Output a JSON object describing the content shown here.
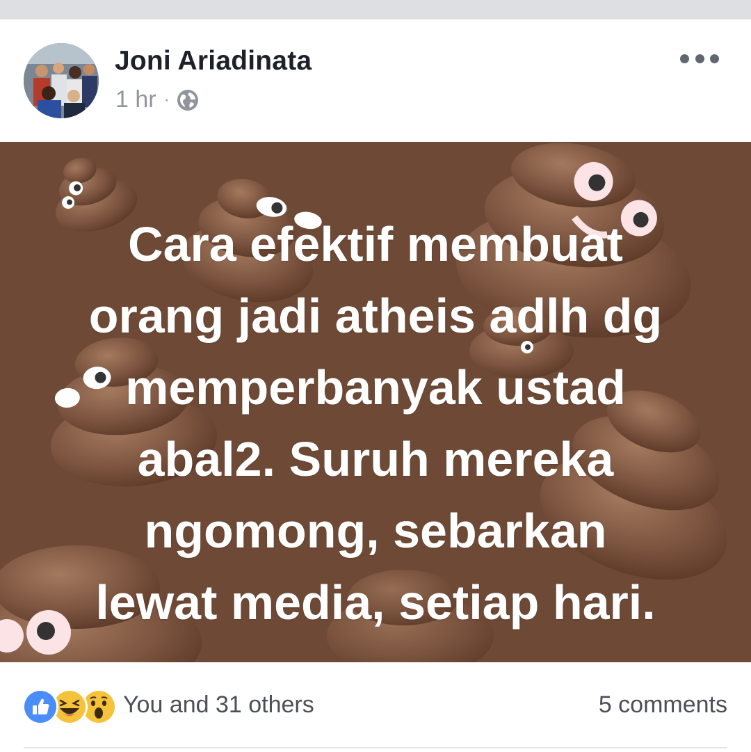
{
  "post": {
    "author": "Joni Ariadinata",
    "time": "1 hr",
    "separator": "·",
    "privacy_icon": "globe-icon",
    "more_icon": "more-options-icon",
    "image_text_lines": [
      "Cara efektif membuat",
      "orang jadi atheis adlh dg",
      "memperbanyak ustad",
      "abal2. Suruh mereka",
      "ngomong, sebarkan",
      "lewat media, setiap hari."
    ],
    "image_background_color": "#6e4a36",
    "image_decoration": "poop-emoji-pattern"
  },
  "footer": {
    "reaction_icons": [
      "like-icon",
      "haha-icon",
      "wow-icon"
    ],
    "reactions_text": "You and 31 others",
    "comments_text": "5 comments"
  },
  "colors": {
    "like_blue": "#4a8df8",
    "reaction_yellow": "#f5c33b",
    "text_dark": "#1d2129",
    "text_meta": "#90949c"
  }
}
